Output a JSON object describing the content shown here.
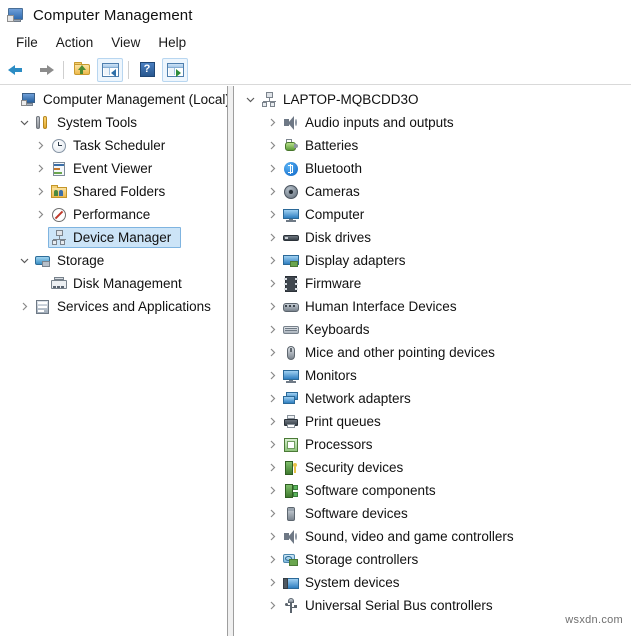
{
  "window": {
    "title": "Computer Management",
    "icon": "computer-management-icon"
  },
  "menubar": {
    "items": [
      {
        "label": "File"
      },
      {
        "label": "Action"
      },
      {
        "label": "View"
      },
      {
        "label": "Help"
      }
    ]
  },
  "toolbar": {
    "buttons": [
      {
        "name": "back-button",
        "icon": "back-arrow-icon",
        "tooltip": "Back"
      },
      {
        "name": "forward-button",
        "icon": "forward-arrow-icon",
        "tooltip": "Forward"
      },
      {
        "name": "up-one-level-button",
        "icon": "folder-up-icon",
        "tooltip": "Up One Level"
      },
      {
        "name": "show-hide-console-tree-button",
        "icon": "console-tree-icon",
        "tooltip": "Show/Hide Console Tree"
      },
      {
        "name": "help-button",
        "icon": "help-icon",
        "tooltip": "Help"
      },
      {
        "name": "show-hide-action-pane-button",
        "icon": "action-pane-icon",
        "tooltip": "Show/Hide Action Pane"
      }
    ]
  },
  "console_tree": {
    "root": {
      "label": "Computer Management (Local)",
      "icon": "computer-management-icon",
      "indent": 0,
      "chevron": "none",
      "selected": false
    },
    "items": [
      {
        "label": "System Tools",
        "icon": "system-tools-icon",
        "indent": 1,
        "chevron": "expanded",
        "selected": false
      },
      {
        "label": "Task Scheduler",
        "icon": "task-scheduler-icon",
        "indent": 2,
        "chevron": "collapsed",
        "selected": false
      },
      {
        "label": "Event Viewer",
        "icon": "event-viewer-icon",
        "indent": 2,
        "chevron": "collapsed",
        "selected": false
      },
      {
        "label": "Shared Folders",
        "icon": "shared-folders-icon",
        "indent": 2,
        "chevron": "collapsed",
        "selected": false
      },
      {
        "label": "Performance",
        "icon": "performance-icon",
        "indent": 2,
        "chevron": "collapsed",
        "selected": false
      },
      {
        "label": "Device Manager",
        "icon": "device-manager-icon",
        "indent": 2,
        "chevron": "none",
        "selected": true
      },
      {
        "label": "Storage",
        "icon": "storage-icon",
        "indent": 1,
        "chevron": "expanded",
        "selected": false
      },
      {
        "label": "Disk Management",
        "icon": "disk-management-icon",
        "indent": 2,
        "chevron": "none",
        "selected": false
      },
      {
        "label": "Services and Applications",
        "icon": "services-applications-icon",
        "indent": 1,
        "chevron": "collapsed",
        "selected": false
      }
    ]
  },
  "device_tree": {
    "root": {
      "label": "LAPTOP-MQBCDD3O",
      "icon": "computer-node-icon",
      "chevron": "expanded"
    },
    "items": [
      {
        "label": "Audio inputs and outputs",
        "icon": "speaker-icon",
        "chevron": "collapsed"
      },
      {
        "label": "Batteries",
        "icon": "battery-icon",
        "chevron": "collapsed"
      },
      {
        "label": "Bluetooth",
        "icon": "bluetooth-icon",
        "chevron": "collapsed"
      },
      {
        "label": "Cameras",
        "icon": "camera-icon",
        "chevron": "collapsed"
      },
      {
        "label": "Computer",
        "icon": "monitor-icon",
        "chevron": "collapsed"
      },
      {
        "label": "Disk drives",
        "icon": "disk-drive-icon",
        "chevron": "collapsed"
      },
      {
        "label": "Display adapters",
        "icon": "display-adapter-icon",
        "chevron": "collapsed"
      },
      {
        "label": "Firmware",
        "icon": "firmware-icon",
        "chevron": "collapsed"
      },
      {
        "label": "Human Interface Devices",
        "icon": "hid-icon",
        "chevron": "collapsed"
      },
      {
        "label": "Keyboards",
        "icon": "keyboard-icon",
        "chevron": "collapsed"
      },
      {
        "label": "Mice and other pointing devices",
        "icon": "mouse-icon",
        "chevron": "collapsed"
      },
      {
        "label": "Monitors",
        "icon": "monitor-icon",
        "chevron": "collapsed"
      },
      {
        "label": "Network adapters",
        "icon": "network-adapter-icon",
        "chevron": "collapsed"
      },
      {
        "label": "Print queues",
        "icon": "printer-icon",
        "chevron": "collapsed"
      },
      {
        "label": "Processors",
        "icon": "processor-icon",
        "chevron": "collapsed"
      },
      {
        "label": "Security devices",
        "icon": "security-device-icon",
        "chevron": "collapsed"
      },
      {
        "label": "Software components",
        "icon": "software-component-icon",
        "chevron": "collapsed"
      },
      {
        "label": "Software devices",
        "icon": "software-device-icon",
        "chevron": "collapsed"
      },
      {
        "label": "Sound, video and game controllers",
        "icon": "speaker-icon",
        "chevron": "collapsed"
      },
      {
        "label": "Storage controllers",
        "icon": "storage-controller-icon",
        "chevron": "collapsed"
      },
      {
        "label": "System devices",
        "icon": "system-device-icon",
        "chevron": "collapsed"
      },
      {
        "label": "Universal Serial Bus controllers",
        "icon": "usb-icon",
        "chevron": "collapsed"
      }
    ]
  },
  "watermark": {
    "text": "wsxdn.com"
  },
  "colors": {
    "selection_fill": "#cce4f7",
    "selection_border": "#7fb4e0",
    "window_bg": "#ffffff",
    "divider": "#9e9e9e",
    "toolbar_frame": "#b8d6f0"
  }
}
